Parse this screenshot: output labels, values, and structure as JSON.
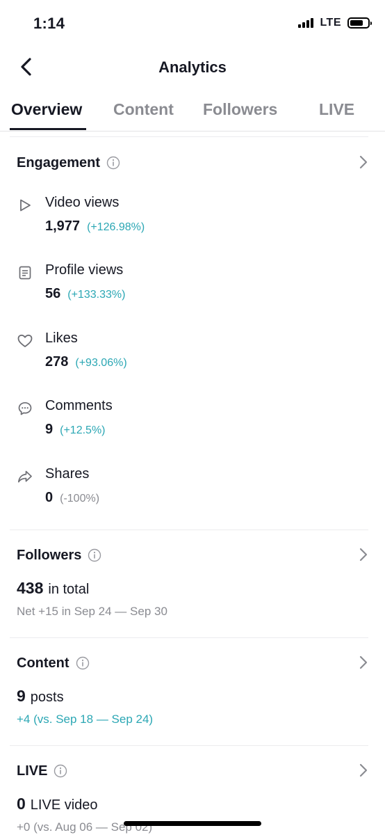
{
  "status_bar": {
    "time": "1:14",
    "network": "LTE"
  },
  "header": {
    "title": "Analytics"
  },
  "tabs": [
    {
      "label": "Overview",
      "active": true
    },
    {
      "label": "Content",
      "active": false
    },
    {
      "label": "Followers",
      "active": false
    },
    {
      "label": "LIVE",
      "active": false
    }
  ],
  "engagement": {
    "title": "Engagement",
    "metrics": [
      {
        "label": "Video views",
        "value": "1,977",
        "change": "(+126.98%)",
        "icon": "play-icon"
      },
      {
        "label": "Profile views",
        "value": "56",
        "change": "(+133.33%)",
        "icon": "profile-doc-icon"
      },
      {
        "label": "Likes",
        "value": "278",
        "change": "(+93.06%)",
        "icon": "heart-icon"
      },
      {
        "label": "Comments",
        "value": "9",
        "change": "(+12.5%)",
        "icon": "comment-icon"
      },
      {
        "label": "Shares",
        "value": "0",
        "change": "(-100%)",
        "icon": "share-icon"
      }
    ]
  },
  "followers": {
    "title": "Followers",
    "total": "438",
    "total_suffix": "in total",
    "net": "Net +15 in Sep 24 — Sep 30"
  },
  "content": {
    "title": "Content",
    "posts": "9",
    "posts_suffix": "posts",
    "change": "+4 (vs. Sep 18 — Sep 24)"
  },
  "live": {
    "title": "LIVE",
    "count": "0",
    "count_suffix": "LIVE video",
    "change": "+0 (vs. Aug 06 — Sep 02)"
  },
  "colors": {
    "accent": "#2ba7b4",
    "text": "#161823",
    "muted": "#8a8b91"
  }
}
